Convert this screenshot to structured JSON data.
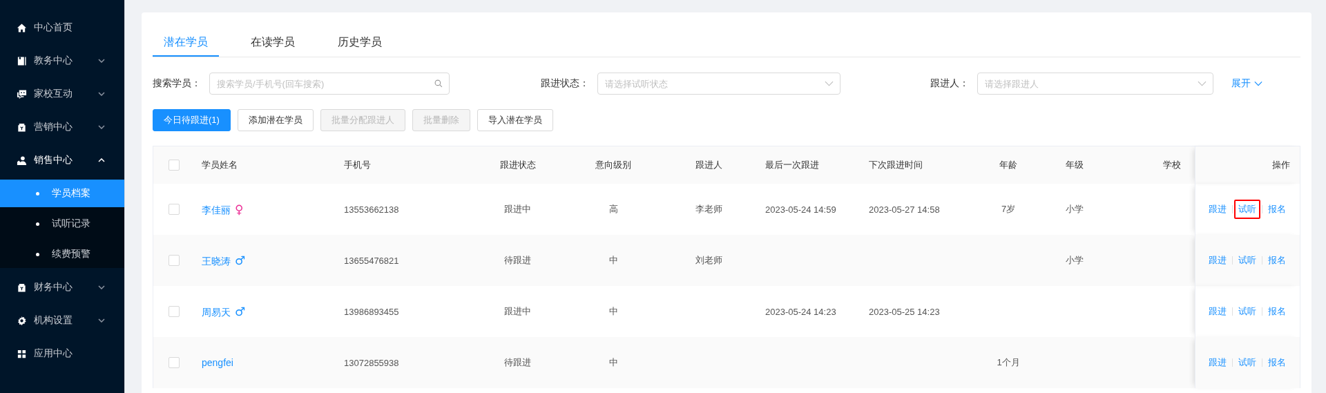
{
  "sidebar": {
    "items": [
      {
        "label": "中心首页",
        "expandable": false,
        "expanded": false
      },
      {
        "label": "教务中心",
        "expandable": true,
        "expanded": false
      },
      {
        "label": "家校互动",
        "expandable": true,
        "expanded": false
      },
      {
        "label": "营销中心",
        "expandable": true,
        "expanded": false
      },
      {
        "label": "销售中心",
        "expandable": true,
        "expanded": true,
        "children": [
          {
            "label": "学员档案",
            "selected": true
          },
          {
            "label": "试听记录",
            "selected": false
          },
          {
            "label": "续费预警",
            "selected": false
          }
        ]
      },
      {
        "label": "财务中心",
        "expandable": true,
        "expanded": false
      },
      {
        "label": "机构设置",
        "expandable": true,
        "expanded": false
      },
      {
        "label": "应用中心",
        "expandable": false,
        "expanded": false
      }
    ]
  },
  "tabs": [
    {
      "label": "潜在学员",
      "selected": true
    },
    {
      "label": "在读学员",
      "selected": false
    },
    {
      "label": "历史学员",
      "selected": false
    }
  ],
  "filters": [
    {
      "label": "搜索学员：",
      "kind": "search",
      "placeholder": "搜索学员/手机号(回车搜索)"
    },
    {
      "label": "跟进状态：",
      "kind": "select",
      "placeholder": "请选择试听状态"
    },
    {
      "label": "跟进人：",
      "kind": "select",
      "placeholder": "请选择跟进人"
    }
  ],
  "expand_link": "展开",
  "buttons": [
    {
      "label": "今日待跟进(1)",
      "kind": "primary",
      "disabled": false
    },
    {
      "label": "添加潜在学员",
      "kind": "default",
      "disabled": false
    },
    {
      "label": "批量分配跟进人",
      "kind": "default",
      "disabled": true
    },
    {
      "label": "批量删除",
      "kind": "default",
      "disabled": true
    },
    {
      "label": "导入潜在学员",
      "kind": "default",
      "disabled": false
    }
  ],
  "table": {
    "select_all_checked": false,
    "columns": [
      "学员姓名",
      "手机号",
      "跟进状态",
      "意向级别",
      "跟进人",
      "最后一次跟进",
      "下次跟进时间",
      "年龄",
      "年级",
      "学校",
      "操作"
    ],
    "rows": [
      {
        "checked": false,
        "name": "李佳丽",
        "gender": "♀",
        "color": "#eb2f96",
        "phone": "13553662138",
        "status": "跟进中",
        "intent": "高",
        "follower": "李老师",
        "last": "2023-05-24 14:59",
        "next": "2023-05-27 14:58",
        "age": "7岁",
        "grade": "小学",
        "actions": [
          {
            "label": "跟进",
            "highlighted": false
          },
          {
            "label": "试听",
            "highlighted": true
          },
          {
            "label": "报名",
            "highlighted": false
          }
        ]
      },
      {
        "checked": false,
        "name": "王晓涛",
        "gender": "♂",
        "color": "#1890ff",
        "phone": "13655476821",
        "status": "待跟进",
        "intent": "中",
        "follower": "刘老师",
        "grade": "小学",
        "actions": [
          {
            "label": "跟进",
            "highlighted": false
          },
          {
            "label": "试听",
            "highlighted": false
          },
          {
            "label": "报名",
            "highlighted": false
          }
        ]
      },
      {
        "checked": false,
        "name": "周易天",
        "gender": "♂",
        "color": "#1890ff",
        "phone": "13986893455",
        "status": "跟进中",
        "intent": "中",
        "last": "2023-05-24 14:23",
        "next": "2023-05-25 14:23",
        "actions": [
          {
            "label": "跟进",
            "highlighted": false
          },
          {
            "label": "试听",
            "highlighted": false
          },
          {
            "label": "报名",
            "highlighted": false
          }
        ]
      },
      {
        "checked": false,
        "name": "pengfei",
        "phone": "13072855938",
        "status": "待跟进",
        "intent": "中",
        "age": "1个月",
        "actions": [
          {
            "label": "跟进",
            "highlighted": false
          },
          {
            "label": "试听",
            "highlighted": false
          },
          {
            "label": "报名",
            "highlighted": false
          }
        ]
      }
    ]
  }
}
